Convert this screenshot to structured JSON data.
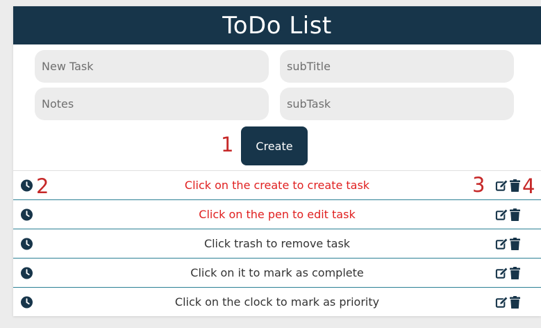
{
  "app": {
    "title": "ToDo List"
  },
  "form": {
    "task_placeholder": "New Task",
    "subtitle_placeholder": "subTitle",
    "notes_placeholder": "Notes",
    "subtask_placeholder": "subTask",
    "create_label": "Create"
  },
  "annotations": [
    "1",
    "2",
    "3",
    "4"
  ],
  "tasks": [
    {
      "text": "Click on the create to create task",
      "color": "#e02020"
    },
    {
      "text": "Click on the pen to edit task",
      "color": "#e02020"
    },
    {
      "text": "Click trash to remove task",
      "color": "#333333"
    },
    {
      "text": "Click on it to mark as complete",
      "color": "#333333"
    },
    {
      "text": "Click on the clock to mark as priority",
      "color": "#333333"
    }
  ],
  "icons": {
    "row": [
      "clock-icon",
      "edit-icon",
      "trash-icon"
    ]
  },
  "colors": {
    "header": "#17354a",
    "annotation": "#c62828",
    "divider": "#2a7f94"
  }
}
